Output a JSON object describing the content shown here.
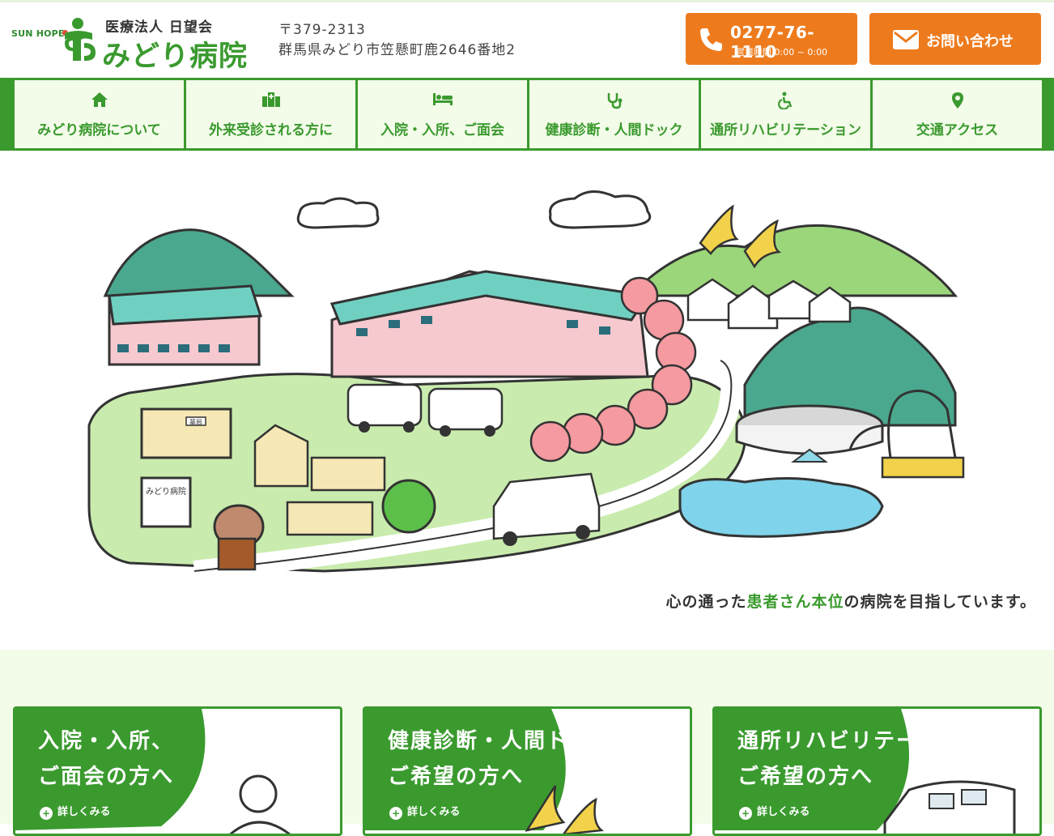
{
  "header": {
    "logo_sunhope": "SUN HOPE",
    "logo_sub": "医療法人 日望会",
    "logo_name": "みどり病院",
    "postal": "〒379-2313",
    "address": "群馬県みどり市笠懸町鹿2646番地2",
    "tel": {
      "number": "0277-76-1110",
      "hours": "営業時間 0:00 ~ 0:00",
      "icon": "phone-icon"
    },
    "contact": {
      "label": "お問い合わせ",
      "icon": "mail-icon"
    }
  },
  "nav": [
    {
      "label": "みどり病院について",
      "icon": "home-icon"
    },
    {
      "label": "外来受診される方に",
      "icon": "hospital-icon"
    },
    {
      "label": "入院・入所、ご面会",
      "icon": "bed-icon"
    },
    {
      "label": "健康診断・人間ドック",
      "icon": "stethoscope-icon"
    },
    {
      "label": "通所リハビリテーション",
      "icon": "wheelchair-icon"
    },
    {
      "label": "交通アクセス",
      "icon": "map-pin-icon"
    }
  ],
  "hero": {
    "tagline_pre": "心の通った",
    "tagline_highlight": "患者さん本位",
    "tagline_post": "の病院を目指しています。",
    "signboard": "みどり病院",
    "pharmacy_sign": "薬局"
  },
  "cards": [
    {
      "line1": "入院・入所、",
      "line2": "ご面会の方へ",
      "more": "詳しくみる"
    },
    {
      "line1": "健康診断・人間ドックを",
      "line2": "ご希望の方へ",
      "more": "詳しくみる"
    },
    {
      "line1": "通所リハビリテーションを",
      "line2": "ご希望の方へ",
      "more": "詳しくみる"
    }
  ],
  "colors": {
    "brand_green": "#3a9a2e",
    "accent_orange": "#ed7b1d",
    "light_green": "#f3fbe9"
  }
}
